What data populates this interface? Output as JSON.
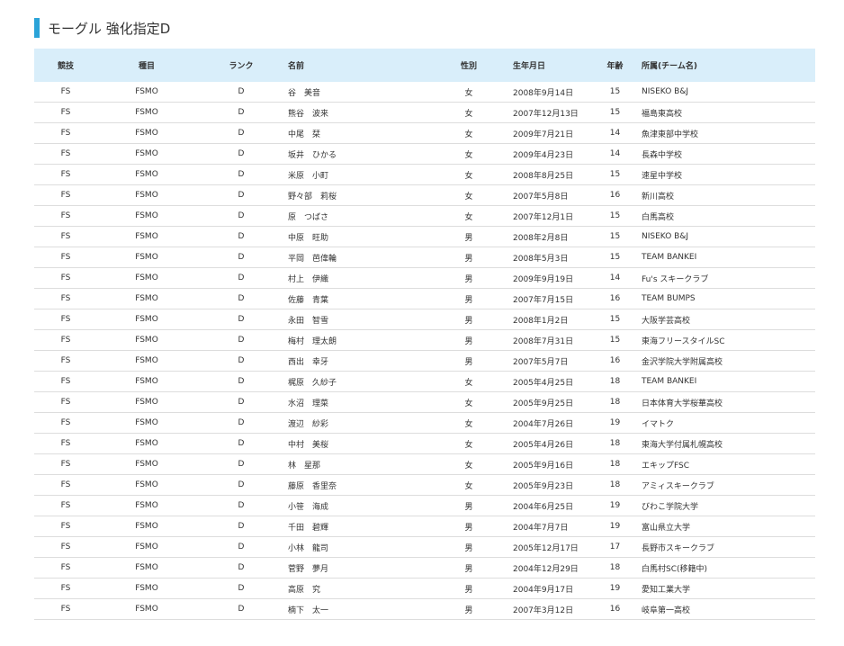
{
  "heading": "モーグル 強化指定D",
  "table": {
    "headers": {
      "sport": "競技",
      "event": "種目",
      "rank": "ランク",
      "name": "名前",
      "gender": "性別",
      "birthdate": "生年月日",
      "age": "年齢",
      "team": "所属(チーム名)"
    },
    "rows": [
      {
        "sport": "FS",
        "event": "FSMO",
        "rank": "D",
        "name": "谷　美音",
        "gender": "女",
        "birthdate": "2008年9月14日",
        "age": "15",
        "team": "NISEKO B&J"
      },
      {
        "sport": "FS",
        "event": "FSMO",
        "rank": "D",
        "name": "熊谷　波来",
        "gender": "女",
        "birthdate": "2007年12月13日",
        "age": "15",
        "team": "福島東高校"
      },
      {
        "sport": "FS",
        "event": "FSMO",
        "rank": "D",
        "name": "中尾　栞",
        "gender": "女",
        "birthdate": "2009年7月21日",
        "age": "14",
        "team": "魚津東部中学校"
      },
      {
        "sport": "FS",
        "event": "FSMO",
        "rank": "D",
        "name": "坂井　ひかる",
        "gender": "女",
        "birthdate": "2009年4月23日",
        "age": "14",
        "team": "長森中学校"
      },
      {
        "sport": "FS",
        "event": "FSMO",
        "rank": "D",
        "name": "米原　小町",
        "gender": "女",
        "birthdate": "2008年8月25日",
        "age": "15",
        "team": "速星中学校"
      },
      {
        "sport": "FS",
        "event": "FSMO",
        "rank": "D",
        "name": "野々部　莉桜",
        "gender": "女",
        "birthdate": "2007年5月8日",
        "age": "16",
        "team": "新川高校"
      },
      {
        "sport": "FS",
        "event": "FSMO",
        "rank": "D",
        "name": "原　つばさ",
        "gender": "女",
        "birthdate": "2007年12月1日",
        "age": "15",
        "team": "白馬高校"
      },
      {
        "sport": "FS",
        "event": "FSMO",
        "rank": "D",
        "name": "中原　旺助",
        "gender": "男",
        "birthdate": "2008年2月8日",
        "age": "15",
        "team": "NISEKO B&J"
      },
      {
        "sport": "FS",
        "event": "FSMO",
        "rank": "D",
        "name": "平岡　芭偉輪",
        "gender": "男",
        "birthdate": "2008年5月3日",
        "age": "15",
        "team": "TEAM BANKEI"
      },
      {
        "sport": "FS",
        "event": "FSMO",
        "rank": "D",
        "name": "村上　伊織",
        "gender": "男",
        "birthdate": "2009年9月19日",
        "age": "14",
        "team": "Fu's スキークラブ"
      },
      {
        "sport": "FS",
        "event": "FSMO",
        "rank": "D",
        "name": "佐藤　青葉",
        "gender": "男",
        "birthdate": "2007年7月15日",
        "age": "16",
        "team": "TEAM BUMPS"
      },
      {
        "sport": "FS",
        "event": "FSMO",
        "rank": "D",
        "name": "永田　智雪",
        "gender": "男",
        "birthdate": "2008年1月2日",
        "age": "15",
        "team": "大阪学芸高校"
      },
      {
        "sport": "FS",
        "event": "FSMO",
        "rank": "D",
        "name": "梅村　理太朗",
        "gender": "男",
        "birthdate": "2008年7月31日",
        "age": "15",
        "team": "東海フリースタイルSC"
      },
      {
        "sport": "FS",
        "event": "FSMO",
        "rank": "D",
        "name": "西出　幸牙",
        "gender": "男",
        "birthdate": "2007年5月7日",
        "age": "16",
        "team": "金沢学院大学附属高校"
      },
      {
        "sport": "FS",
        "event": "FSMO",
        "rank": "D",
        "name": "梶原　久紗子",
        "gender": "女",
        "birthdate": "2005年4月25日",
        "age": "18",
        "team": "TEAM BANKEI"
      },
      {
        "sport": "FS",
        "event": "FSMO",
        "rank": "D",
        "name": "水沼　理菜",
        "gender": "女",
        "birthdate": "2005年9月25日",
        "age": "18",
        "team": "日本体育大学桜華高校"
      },
      {
        "sport": "FS",
        "event": "FSMO",
        "rank": "D",
        "name": "渡辺　紗彩",
        "gender": "女",
        "birthdate": "2004年7月26日",
        "age": "19",
        "team": "イマトク"
      },
      {
        "sport": "FS",
        "event": "FSMO",
        "rank": "D",
        "name": "中村　美桜",
        "gender": "女",
        "birthdate": "2005年4月26日",
        "age": "18",
        "team": "東海大学付属札幌高校"
      },
      {
        "sport": "FS",
        "event": "FSMO",
        "rank": "D",
        "name": "林　星那",
        "gender": "女",
        "birthdate": "2005年9月16日",
        "age": "18",
        "team": "エキップFSC"
      },
      {
        "sport": "FS",
        "event": "FSMO",
        "rank": "D",
        "name": "藤原　香里奈",
        "gender": "女",
        "birthdate": "2005年9月23日",
        "age": "18",
        "team": "アミィスキークラブ"
      },
      {
        "sport": "FS",
        "event": "FSMO",
        "rank": "D",
        "name": "小笹　海成",
        "gender": "男",
        "birthdate": "2004年6月25日",
        "age": "19",
        "team": "びわこ学院大学"
      },
      {
        "sport": "FS",
        "event": "FSMO",
        "rank": "D",
        "name": "千田　碧輝",
        "gender": "男",
        "birthdate": "2004年7月7日",
        "age": "19",
        "team": "富山県立大学"
      },
      {
        "sport": "FS",
        "event": "FSMO",
        "rank": "D",
        "name": "小林　龍司",
        "gender": "男",
        "birthdate": "2005年12月17日",
        "age": "17",
        "team": "長野市スキークラブ"
      },
      {
        "sport": "FS",
        "event": "FSMO",
        "rank": "D",
        "name": "菅野　夢月",
        "gender": "男",
        "birthdate": "2004年12月29日",
        "age": "18",
        "team": "白馬村SC(移籍中)"
      },
      {
        "sport": "FS",
        "event": "FSMO",
        "rank": "D",
        "name": "高原　究",
        "gender": "男",
        "birthdate": "2004年9月17日",
        "age": "19",
        "team": "愛知工業大学"
      },
      {
        "sport": "FS",
        "event": "FSMO",
        "rank": "D",
        "name": "楠下　太一",
        "gender": "男",
        "birthdate": "2007年3月12日",
        "age": "16",
        "team": "岐阜第一高校"
      }
    ]
  }
}
